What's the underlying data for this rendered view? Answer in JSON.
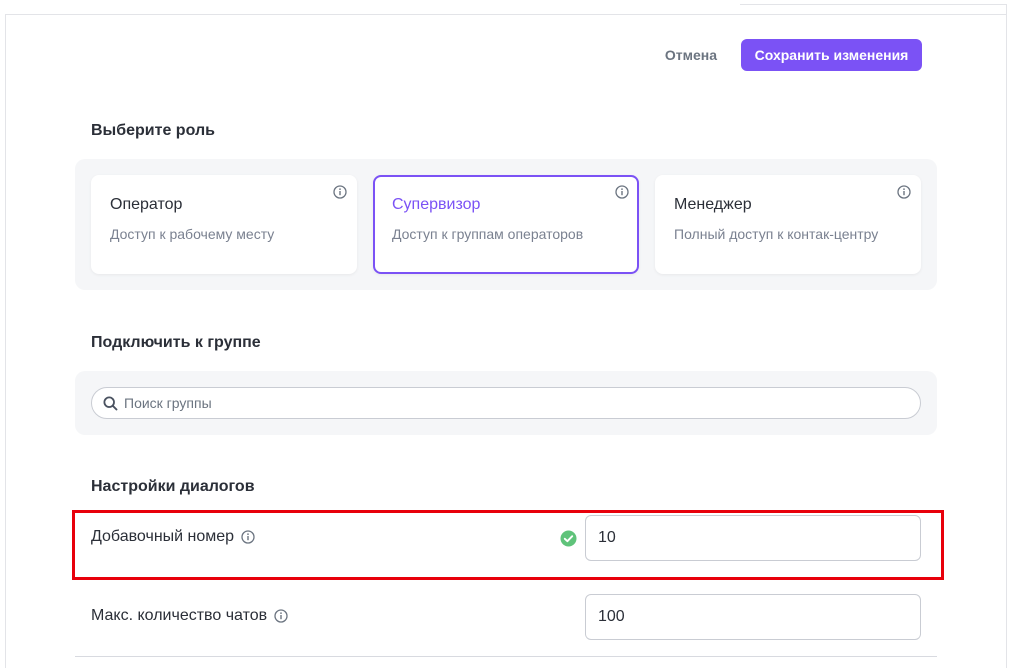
{
  "header": {
    "cancel_label": "Отмена",
    "save_label": "Сохранить изменения"
  },
  "role_section": {
    "title": "Выберите роль",
    "roles": [
      {
        "name": "Оператор",
        "description": "Доступ к рабочему месту",
        "selected": false
      },
      {
        "name": "Супервизор",
        "description": "Доступ к группам операторов",
        "selected": true
      },
      {
        "name": "Менеджер",
        "description": "Полный доступ к контак-центру",
        "selected": false
      }
    ]
  },
  "group_section": {
    "title": "Подключить к группе",
    "search_placeholder": "Поиск группы",
    "search_icon": "search-icon"
  },
  "dialog_section": {
    "title": "Настройки диалогов",
    "extension": {
      "label": "Добавочный номер",
      "value": "10",
      "status_icon": "check-circle-icon",
      "status_color": "#5fc37a"
    },
    "max_chats": {
      "label": "Макс. количество чатов",
      "value": "100"
    }
  },
  "colors": {
    "accent": "#7b52f5",
    "highlight": "#e8000b"
  }
}
